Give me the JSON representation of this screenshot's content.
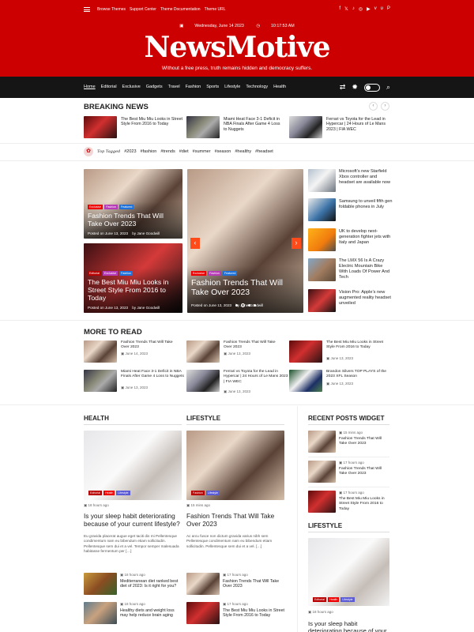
{
  "top_links": [
    "Browse Themes",
    "Support Center",
    "Theme Documentation",
    "Theme URL"
  ],
  "social_icons": [
    "facebook-icon",
    "twitter-icon",
    "tiktok-icon",
    "instagram-icon",
    "youtube-icon",
    "vimeo-icon",
    "vk-icon",
    "pinterest-icon"
  ],
  "date": "Wednesday, June 14 2023",
  "time": "10:17:53 AM",
  "logo": "NewsMotive",
  "tagline": "Without a free press, truth remains hidden and democracy suffers.",
  "nav": [
    "Home",
    "Editorial",
    "Exclusive",
    "Gadgets",
    "Travel",
    "Fashion",
    "Sports",
    "Lifestyle",
    "Technology",
    "Health"
  ],
  "breaking": {
    "title": "BREAKING NEWS",
    "items": [
      "The Best Miu Miu Looks in Street Style From 2016 to Today",
      "Miami Heat Face 3-1 Deficit in NBA Finals After Game 4 Loss to Nuggets",
      "Ferrari vs Toyota for the Lead in Hypercar | 24 Hours of Le Mans 2023 | FIA WEC"
    ]
  },
  "tags": {
    "label": "Top Tagged",
    "items": [
      "#2023",
      "#fashion",
      "#trends",
      "#diet",
      "#summer",
      "#season",
      "#healthy",
      "#headset"
    ]
  },
  "hero": {
    "left_top": {
      "title": "Fashion Trends That Will Take Over 2023",
      "date": "Posted on June 13, 2023",
      "author": "by Jane Goodwill",
      "labels": [
        "Exclusive",
        "Fashion",
        "Featured"
      ]
    },
    "left_bottom": {
      "title": "The Best Miu Miu Looks in Street Style From 2016 to Today",
      "date": "Posted on June 13, 2023",
      "author": "by Jane Goodwill",
      "labels": [
        "Editorial",
        "Exclusive",
        "Fashion"
      ]
    },
    "main": {
      "title": "Fashion Trends That Will Take Over 2023",
      "date": "Posted on June 13, 2023",
      "author": "by Jane Goodwill",
      "labels": [
        "Exclusive",
        "Fashion",
        "Featured"
      ]
    },
    "side": [
      "Microsoft’s new Starfield Xbox controller and headset are available now",
      "Samsung to unveil fifth gen foldable phones in July",
      "UK to develop next-generation fighter jets with Italy and Japan",
      "The LMX 56 Is A Crazy Electric Mountain Bike With Loads Of Power And Tech",
      "Vision Pro: Apple’s new augmented reality headset unveiled"
    ]
  },
  "more": {
    "title": "MORE TO READ",
    "items": [
      {
        "title": "Fashion Trends That Will Take Over 2023",
        "date": "June 14, 2023"
      },
      {
        "title": "Fashion Trends That Will Take Over 2023",
        "date": "June 13, 2023"
      },
      {
        "title": "The Best Miu Miu Looks in Street Style From 2016 to Today",
        "date": "June 13, 2023"
      },
      {
        "title": "Miami Heat Face 3-1 Deficit in NBA Finals After Game 4 Loss to Nuggets",
        "date": "June 13, 2023"
      },
      {
        "title": "Ferrari vs Toyota for the Lead in Hypercar | 24 Hours of Le Mans 2023 | FIA WEC",
        "date": "June 13, 2023"
      },
      {
        "title": "Brandon Silvers TOP PLAYS of the 2023 XFL Season",
        "date": "June 13, 2023"
      }
    ]
  },
  "health": {
    "title": "HEALTH",
    "time": "18 hours ago",
    "headline": "Is your sleep habit deteriorating because of your current lifestyle?",
    "excerpt": "Eu gravida placerat augue eget taciti dis mi Pellentesque condimentum nam eu bibendum etiam sollicitudin. Pellentesque sem dui et a vel. Tempor semper malesuada habitasse fermentum per […]",
    "labels": [
      "Editorial",
      "Health",
      "Lifestyle"
    ],
    "list": [
      {
        "time": "18 hours ago",
        "title": "Mediterranean diet ranked best diet of 2023: Is it right for you?"
      },
      {
        "time": "18 hours ago",
        "title": "Healthy diets and weight loss may help reduce brain aging"
      }
    ]
  },
  "lifestyle": {
    "title": "LIFESTYLE",
    "time": "15 mins ago",
    "headline": "Fashion Trends That Will Take Over 2023",
    "excerpt": "Ac arcu fusce non dictum gravida varius nibh sem Pellentesque condimentum nam eu bibendum etiam sollicitudin. Pellentesque sem dui et a vel. […]",
    "labels": [
      "Fashion",
      "Lifestyle"
    ],
    "list": [
      {
        "time": "17 hours ago",
        "title": "Fashion Trends That Will Take Over 2023"
      },
      {
        "time": "17 hours ago",
        "title": "The Best Miu Miu Looks in Street Style From 2016 to Today"
      }
    ]
  },
  "recent": {
    "title": "RECENT POSTS WIDGET",
    "items": [
      {
        "time": "15 mins ago",
        "title": "Fashion Trends That Will Take Over 2023"
      },
      {
        "time": "17 hours ago",
        "title": "Fashion Trends That Will Take Over 2023"
      },
      {
        "time": "17 hours ago",
        "title": "The Best Miu Miu Looks in Street Style From 2016 to Today"
      }
    ]
  },
  "side_lifestyle": {
    "title": "LIFESTYLE",
    "time": "18 hours ago",
    "headline": "Is your sleep habit deteriorating because of your current",
    "labels": [
      "Editorial",
      "Health",
      "Lifestyle"
    ]
  }
}
